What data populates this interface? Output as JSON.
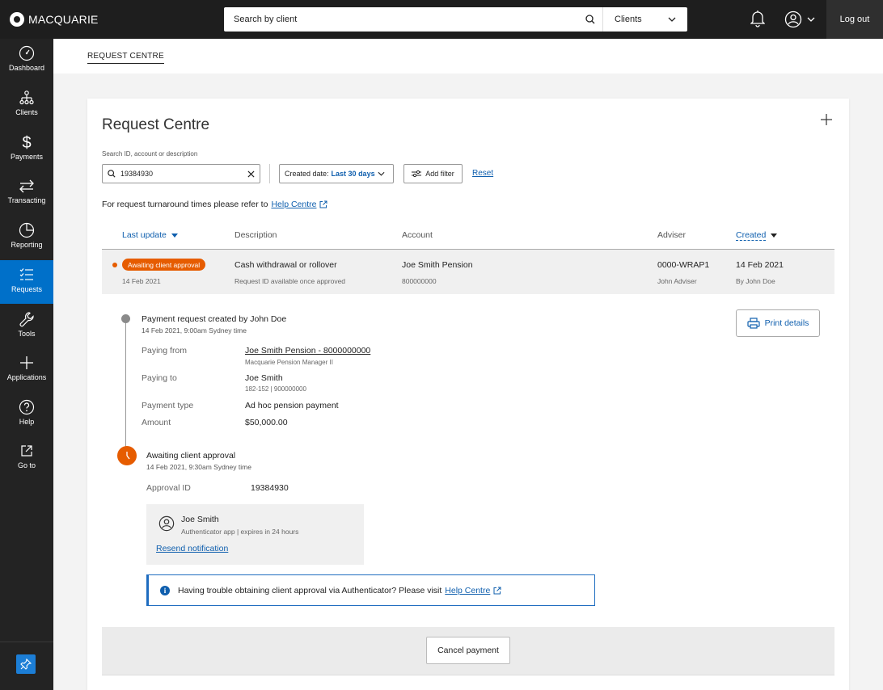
{
  "brand": {
    "name": "MACQUARIE"
  },
  "topbar": {
    "search_placeholder": "Search by client",
    "scope_select": "Clients",
    "logout_label": "Log out"
  },
  "sidebar": {
    "items": [
      {
        "label": "Dashboard",
        "icon": "dashboard-icon"
      },
      {
        "label": "Clients",
        "icon": "clients-icon"
      },
      {
        "label": "Payments",
        "icon": "dollar-icon"
      },
      {
        "label": "Transacting",
        "icon": "transfer-arrows-icon"
      },
      {
        "label": "Reporting",
        "icon": "pie-chart-icon"
      },
      {
        "label": "Requests",
        "icon": "checklist-icon",
        "active": true
      },
      {
        "label": "Tools",
        "icon": "wrench-icon"
      },
      {
        "label": "Applications",
        "icon": "plus-icon"
      },
      {
        "label": "Help",
        "icon": "help-icon"
      },
      {
        "label": "Go to",
        "icon": "external-link-icon"
      }
    ]
  },
  "breadcrumb": "REQUEST CENTRE",
  "page": {
    "title": "Request Centre",
    "search_label": "Search ID, account or description",
    "search_value": "19384930",
    "date_filter_prefix": "Created date:",
    "date_filter_value": "Last 30 days",
    "add_filter_label": "Add filter",
    "reset_label": "Reset",
    "help_text": "For request turnaround times please refer to",
    "help_link": "Help Centre"
  },
  "table": {
    "columns": [
      "Last update",
      "Description",
      "Account",
      "Adviser",
      "Created"
    ],
    "row": {
      "status": "Awaiting client approval",
      "last_update": "14 Feb 2021",
      "description": "Cash withdrawal or rollover",
      "description_sub": "Request ID available once approved",
      "account": "Joe Smith Pension",
      "account_sub": "800000000",
      "adviser": "0000-WRAP1",
      "adviser_sub": "John Adviser",
      "created": "14 Feb 2021",
      "created_sub": "By John Doe"
    }
  },
  "detail": {
    "event1": {
      "title": "Payment request created by John Doe",
      "time": "14 Feb 2021, 9:00am Sydney time"
    },
    "print_label": "Print details",
    "paying_from_label": "Paying from",
    "paying_from_value": "Joe Smith Pension - 8000000000",
    "paying_from_sub": "Macquarie Pension Manager II",
    "paying_to_label": "Paying to",
    "paying_to_value": "Joe Smith",
    "paying_to_sub": "182-152 | 900000000",
    "payment_type_label": "Payment type",
    "payment_type_value": "Ad hoc pension payment",
    "amount_label": "Amount",
    "amount_value": "$50,000.00",
    "event2": {
      "title": "Awaiting client approval",
      "time": "14 Feb 2021, 9:30am Sydney time"
    },
    "approval_id_label": "Approval ID",
    "approval_id_value": "19384930",
    "approver_name": "Joe Smith",
    "approver_sub": "Authenticator app | expires in 24 hours",
    "resend_label": "Resend notification",
    "info_text": "Having trouble obtaining client approval via Authenticator? Please visit",
    "info_link": "Help Centre",
    "cancel_label": "Cancel payment"
  },
  "colors": {
    "accent": "#0f5fae",
    "status": "#e65c00",
    "nav_active": "#0070c9"
  }
}
